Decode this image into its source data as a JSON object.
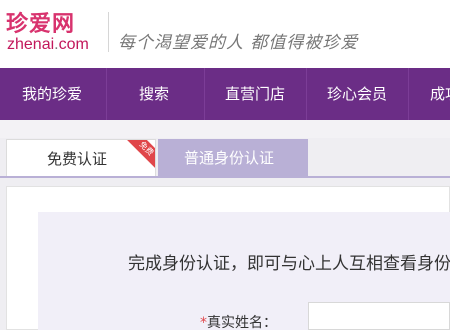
{
  "header": {
    "logo_cn": "珍爱网",
    "logo_en_prefix": "zhen",
    "logo_en_mid": "ai",
    "logo_en_dot": ".",
    "logo_en_suffix": "com",
    "slogan": "每个渴望爱的人 都值得被珍爱"
  },
  "nav": {
    "items": [
      {
        "label": "我的珍爱"
      },
      {
        "label": "搜索"
      },
      {
        "label": "直营门店"
      },
      {
        "label": "珍心会员"
      },
      {
        "label": "成功"
      }
    ]
  },
  "tabs": {
    "free": {
      "label": "免费认证",
      "badge": "免费"
    },
    "normal": {
      "label": "普通身份认证"
    }
  },
  "main": {
    "intro": "完成身份认证，即可与心上人互相查看身份",
    "form": {
      "name_label_required": "*",
      "name_label": "真实姓名：",
      "name_value": "",
      "name_placeholder": ""
    }
  },
  "colors": {
    "brand_pink": "#d8336e",
    "nav_purple": "#6b2d86",
    "tab_active": "#b9b0d6",
    "badge_red": "#e0464a"
  }
}
